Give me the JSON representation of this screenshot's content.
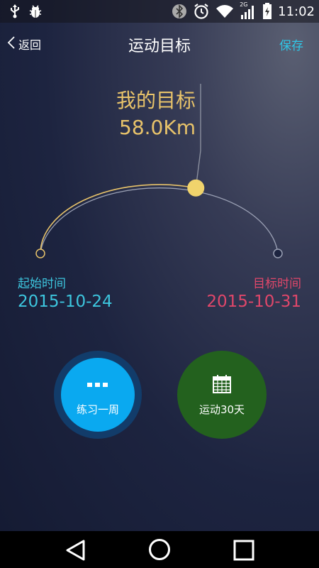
{
  "status_bar": {
    "time": "11:02",
    "network_label": "2G",
    "icons": [
      "usb-icon",
      "bug-icon",
      "bluetooth-icon",
      "alarm-icon",
      "wifi-icon",
      "signal-icon",
      "battery-icon"
    ]
  },
  "header": {
    "back_label": "返回",
    "title": "运动目标",
    "save_label": "保存"
  },
  "goal": {
    "label": "我的目标",
    "value": "58.0Km",
    "progress": 0.6
  },
  "dates": {
    "start_label": "起始时间",
    "start_value": "2015-10-24",
    "end_label": "目标时间",
    "end_value": "2015-10-31"
  },
  "plans": [
    {
      "label": "练习一周",
      "icon": "dots-icon",
      "selected": true
    },
    {
      "label": "运动30天",
      "icon": "calendar-icon",
      "selected": false
    }
  ],
  "colors": {
    "accent_cyan": "#2fc6e6",
    "goal_gold": "#e8c36a",
    "target_red": "#e0476a",
    "week_blue": "#0aa9f0",
    "month_green": "#23611e"
  },
  "nav": {
    "icons": [
      "back-triangle-icon",
      "home-circle-icon",
      "recent-square-icon"
    ]
  }
}
